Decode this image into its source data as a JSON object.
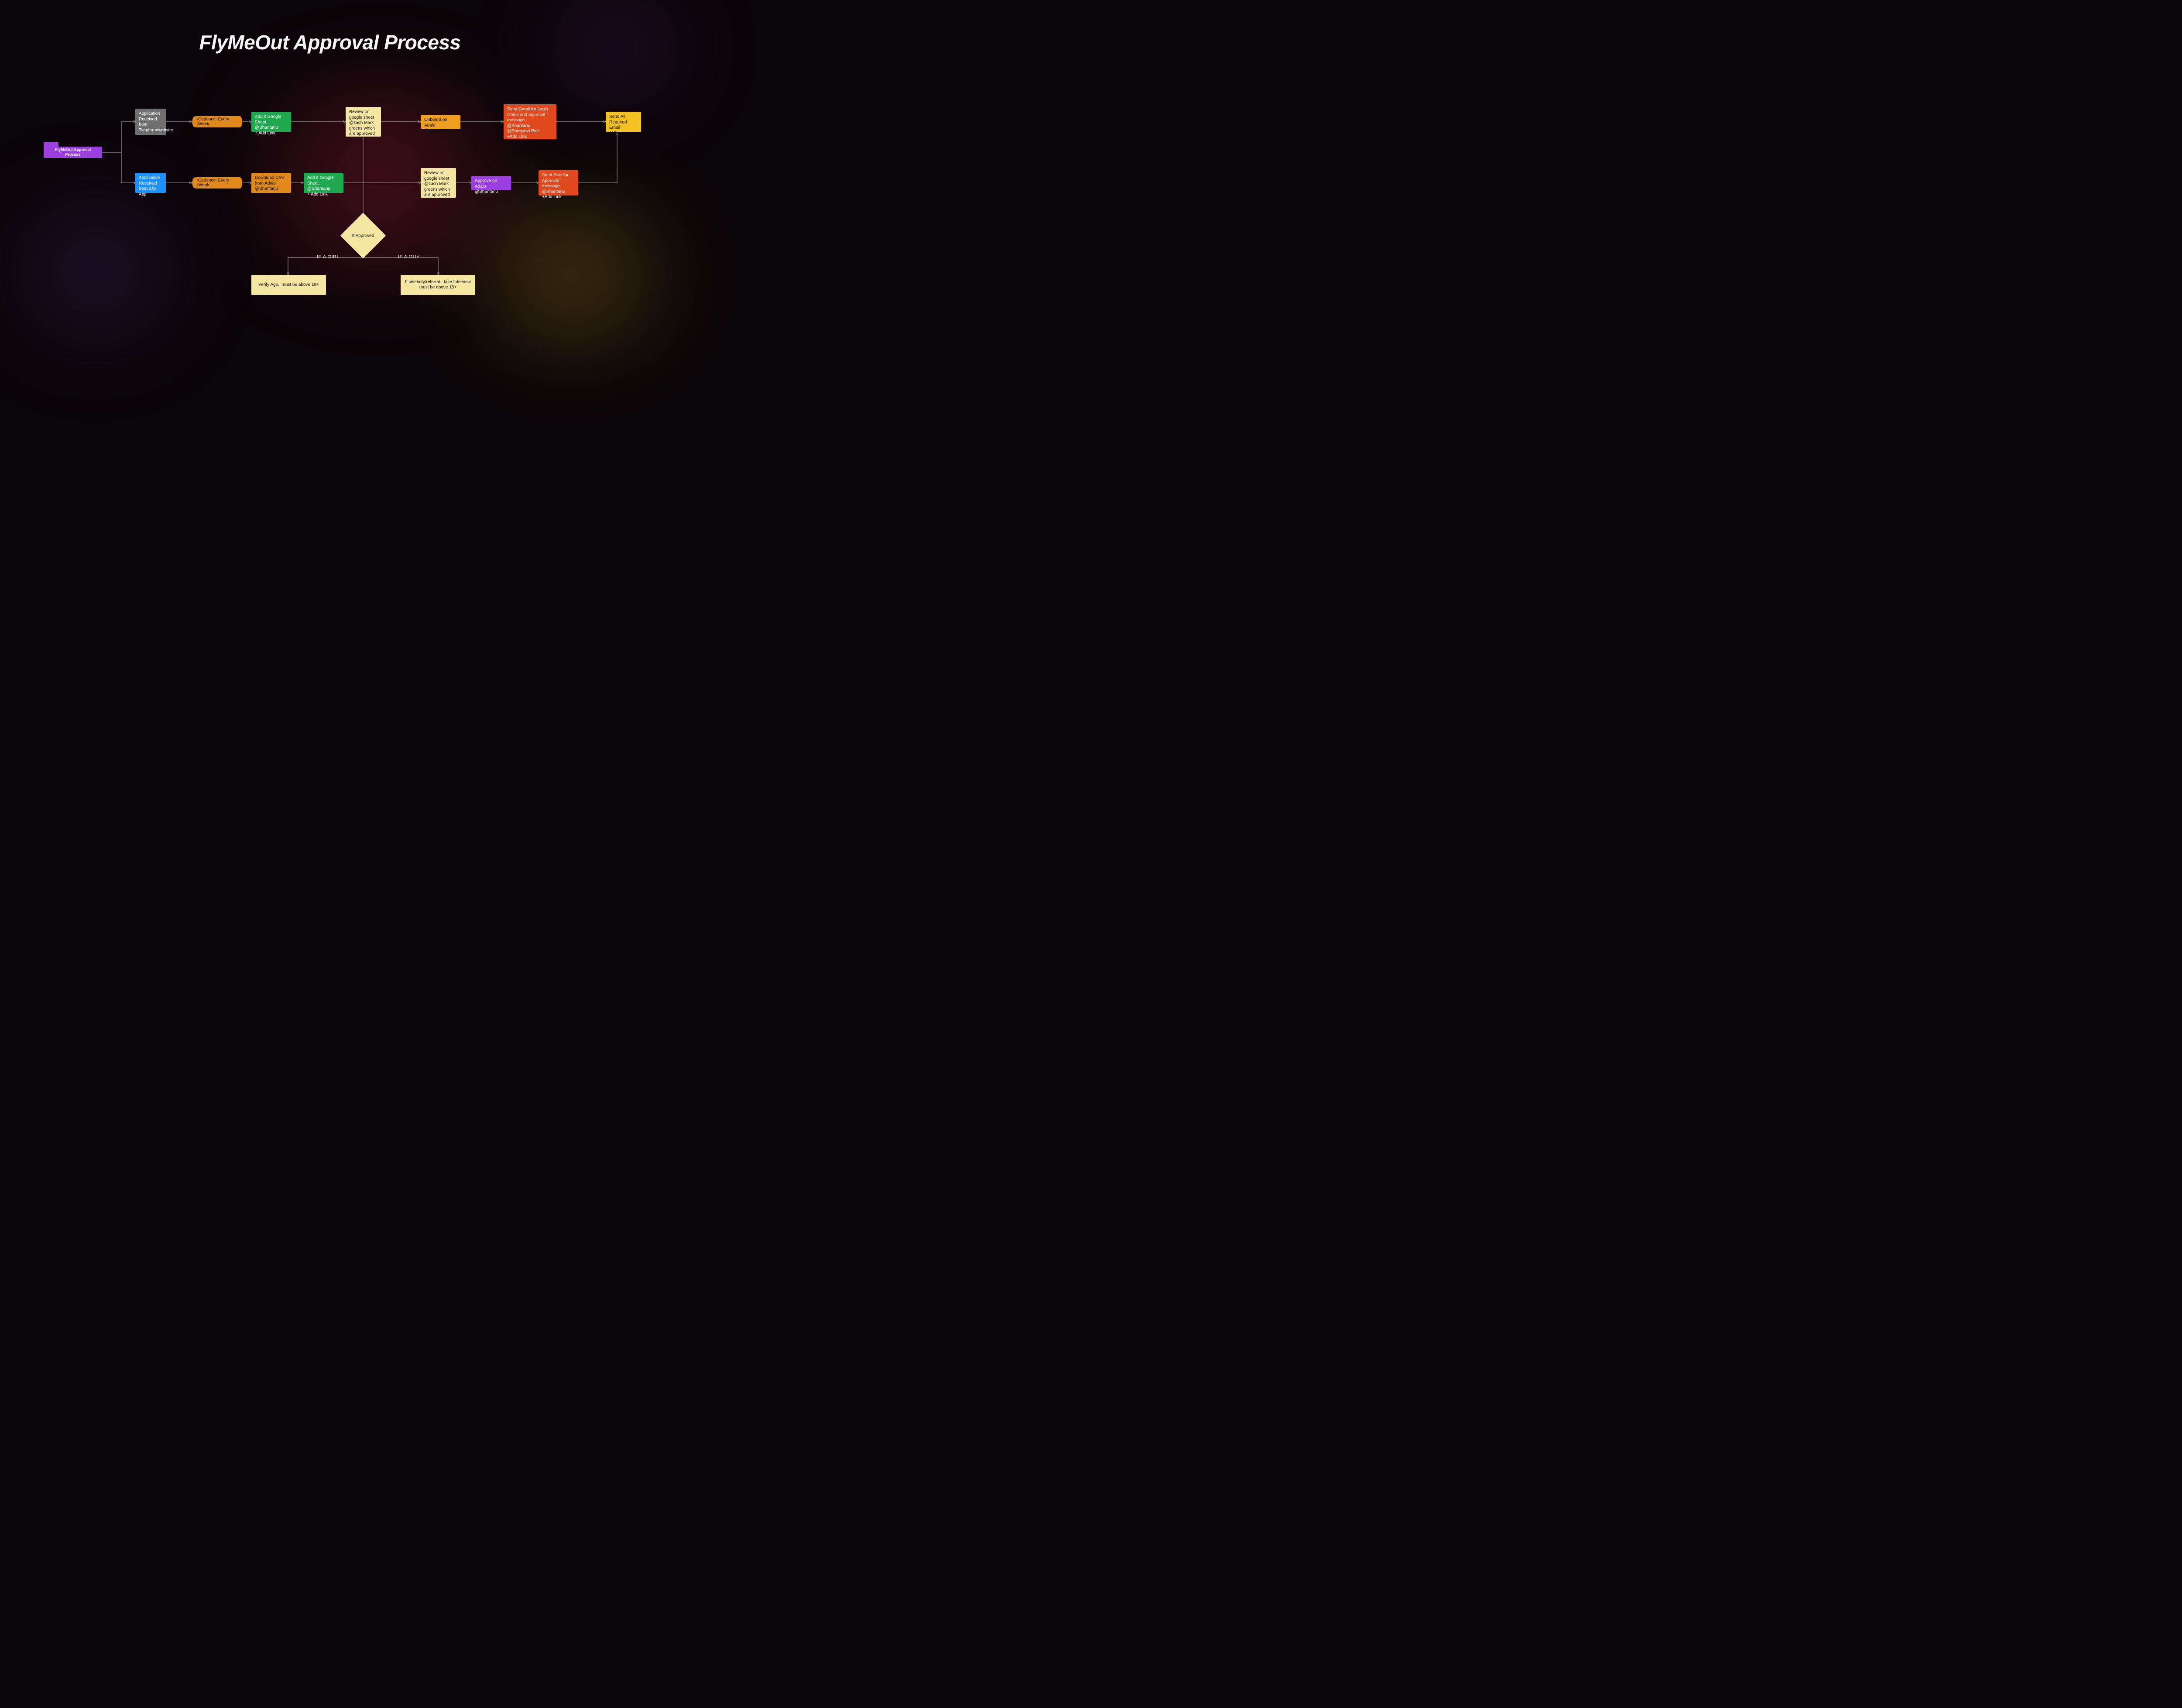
{
  "title": "FlyMeOut Approval Process",
  "nodes": {
    "root": "FlyMeOut Approval Process",
    "app_typeform": "Application Received from Tyepform/website",
    "app_ios": "Application Received from iOS App",
    "cadence1": "Cadence: Every Week",
    "cadence2": "Cadence: Every Week",
    "add_sheet1": "Add it Google Sheet.\n@Shantanu\n+ Add Link",
    "dl_csv": "Download CSV from Adalo @Shantanu",
    "add_sheet2": "Add it Google Sheet.\n@Shantanu\n+ Add Link",
    "review1": "Review on google sheet @zach Mark greens which are approved",
    "review2": "Review on google sheet @zach Mark greens which are approved",
    "onboard": "Onboard on Adalo @Shreyasa",
    "approve": "Approve on Adalo @Shantanu",
    "send_gmail": "Send Gmail for Login Creds and approval message\n@Shantanu\n@Shreyasa Patil\n+Add Link",
    "send_sms": "Send Sms for Approval message @Shantanu\n+Add Link",
    "send_all": "Send All Required Email @Shreyasa",
    "decision": "If Approved",
    "branch_girl": "IF A GIRL",
    "branch_guy": "IF A GUY",
    "girl_box": "Verify Age.. must be above 18+",
    "guy_box": "If celebrity/referral - take Interview must be above 18+"
  },
  "colors": {
    "purple": "#9b3fe0",
    "grey": "#6f6f6f",
    "blue": "#1e90ff",
    "green": "#1fa850",
    "orange": "#e08a1e",
    "amber": "#f0a020",
    "red": "#e04a1e",
    "cream": "#f5e6a3",
    "yellow": "#f5c224"
  }
}
